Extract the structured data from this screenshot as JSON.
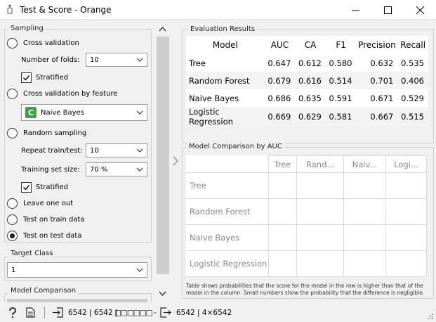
{
  "window": {
    "title": "Test & Score - Orange"
  },
  "sampling": {
    "group_title": "Sampling",
    "options": [
      {
        "label": "Cross validation",
        "checked": false
      },
      {
        "label": "Cross validation by feature",
        "checked": false
      },
      {
        "label": "Random sampling",
        "checked": false
      },
      {
        "label": "Leave one out",
        "checked": false
      },
      {
        "label": "Test on train data",
        "checked": false
      },
      {
        "label": "Test on test data",
        "checked": true
      }
    ],
    "folds_label": "Number of folds:",
    "folds_value": "10",
    "stratified_label": "Stratified",
    "feature_value": "Naive Bayes",
    "feature_badge": "C",
    "repeat_label": "Repeat train/test:",
    "repeat_value": "10",
    "train_size_label": "Training set size:",
    "train_size_value": "70 %",
    "stratified2_label": "Stratified"
  },
  "target_class": {
    "group_title": "Target Class",
    "value": "1"
  },
  "model_comparison": {
    "group_title": "Model Comparison"
  },
  "evaluation": {
    "group_title": "Evaluation Results",
    "columns": [
      "Model",
      "AUC",
      "CA",
      "F1",
      "Precision",
      "Recall"
    ],
    "rows": [
      [
        "Tree",
        "0.647",
        "0.612",
        "0.580",
        "0.632",
        "0.535"
      ],
      [
        "Random Forest",
        "0.679",
        "0.616",
        "0.514",
        "0.701",
        "0.406"
      ],
      [
        "Naive Bayes",
        "0.686",
        "0.635",
        "0.591",
        "0.671",
        "0.529"
      ],
      [
        "Logistic Regression",
        "0.669",
        "0.629",
        "0.581",
        "0.667",
        "0.515"
      ]
    ]
  },
  "comparison": {
    "group_title": "Model Comparison by AUC",
    "col_headers": [
      "Tree",
      "Rand...",
      "Naiv...",
      "Logi..."
    ],
    "row_headers": [
      "Tree",
      "Random Forest",
      "Naive Bayes",
      "Logistic Regression"
    ],
    "note": "Table shows probabilities that the score for the model in the row is higher than that of the model in the column. Small numbers show the probability that the difference is negligible."
  },
  "status": {
    "input_summary": "6542 | 6542 | ",
    "input_extra": "□□□□□□ -",
    "output_summary": "6542 | 4×6542"
  },
  "colors": {
    "accent": "#43a047",
    "splitter": "#cdcdcd"
  }
}
